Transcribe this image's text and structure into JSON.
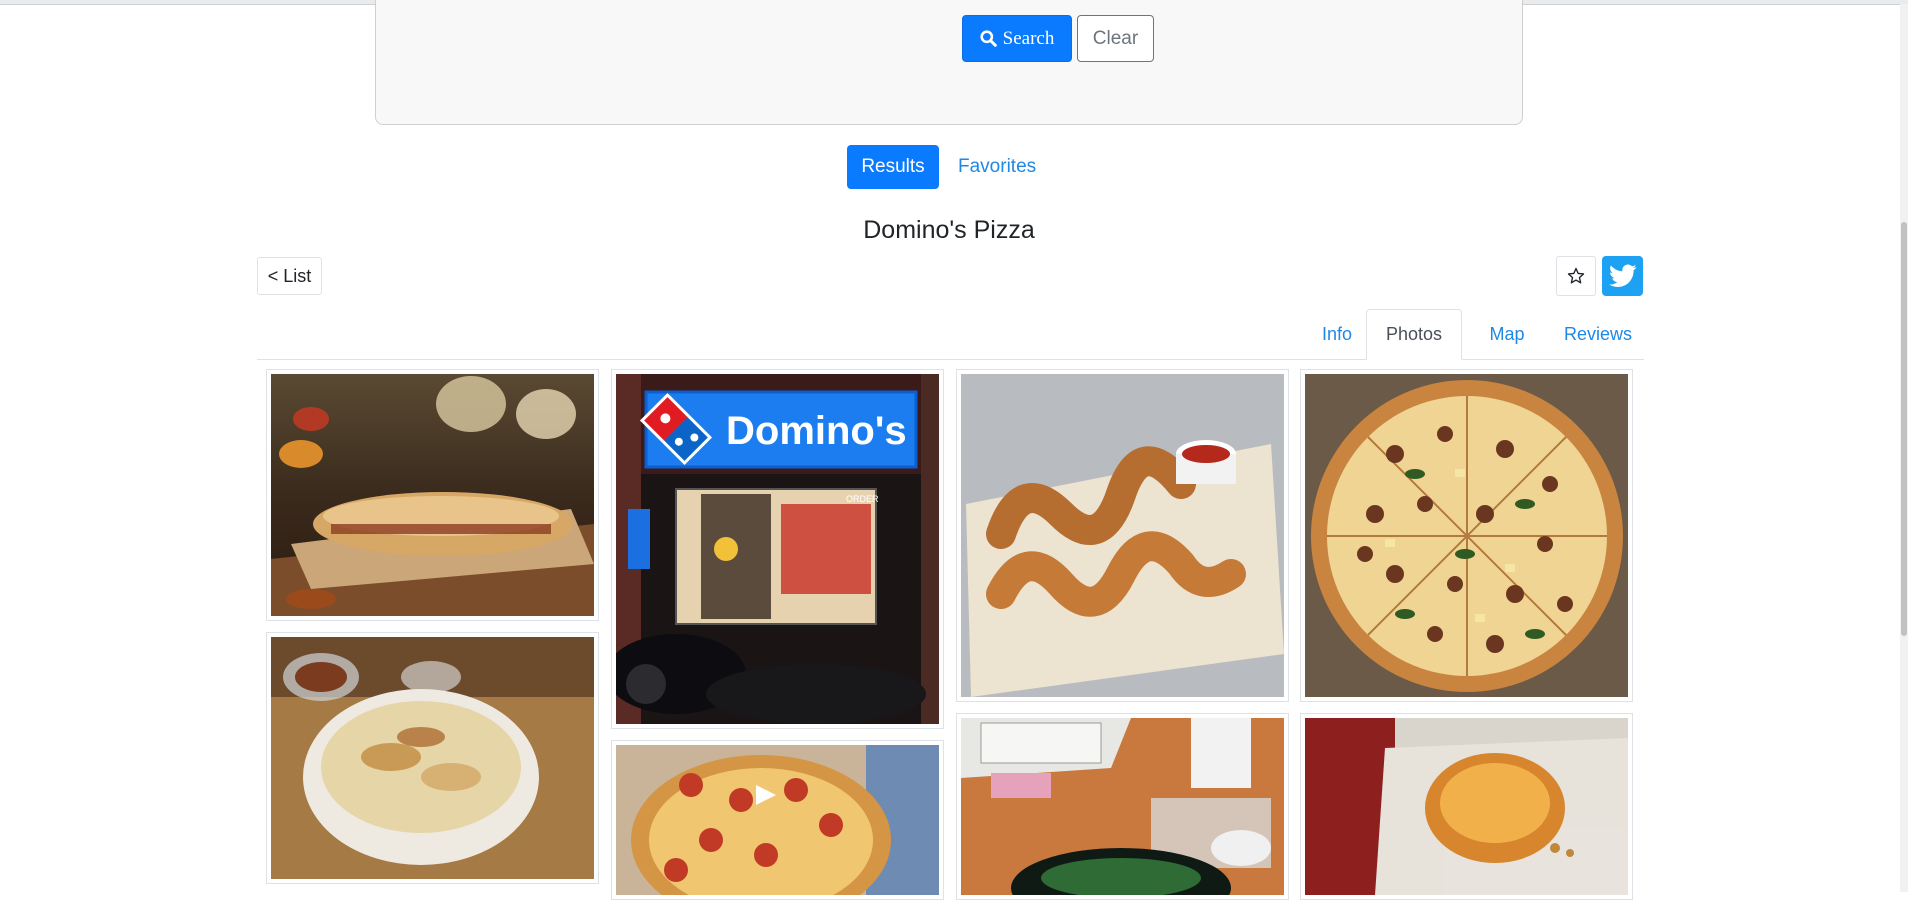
{
  "search": {
    "search_label": "Search",
    "clear_label": "Clear"
  },
  "nav": {
    "results_label": "Results",
    "favorites_label": "Favorites"
  },
  "business": {
    "name": "Domino's Pizza"
  },
  "actions": {
    "back_label": "< List"
  },
  "tabs": [
    {
      "label": "Info",
      "active": false
    },
    {
      "label": "Photos",
      "active": true
    },
    {
      "label": "Map",
      "active": false
    },
    {
      "label": "Reviews",
      "active": false
    }
  ],
  "photos": {
    "storefront_sign": "Domino's",
    "storefront_door_text": "ORDER"
  },
  "colors": {
    "primary": "#0a7bff",
    "link": "#1e88e5",
    "twitter": "#1da1f2"
  }
}
